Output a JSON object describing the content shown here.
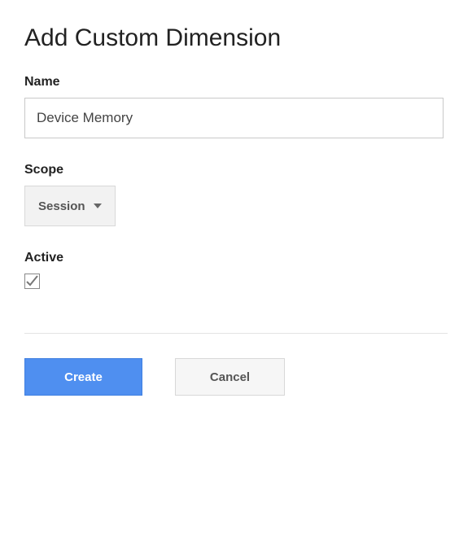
{
  "title": "Add Custom Dimension",
  "fields": {
    "name": {
      "label": "Name",
      "value": "Device Memory"
    },
    "scope": {
      "label": "Scope",
      "selected": "Session"
    },
    "active": {
      "label": "Active",
      "checked": true
    }
  },
  "buttons": {
    "create": "Create",
    "cancel": "Cancel"
  }
}
